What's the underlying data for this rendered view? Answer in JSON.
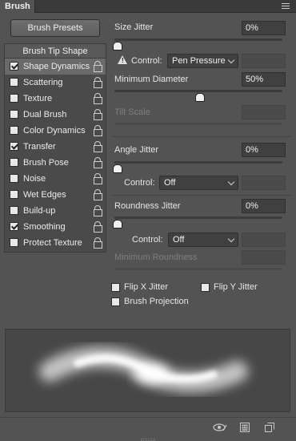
{
  "panel": {
    "title": "Brush"
  },
  "presets_button": "Brush Presets",
  "sidebar": {
    "header": "Brush Tip Shape",
    "items": [
      {
        "label": "Shape Dynamics",
        "checked": true,
        "active": true
      },
      {
        "label": "Scattering",
        "checked": false
      },
      {
        "label": "Texture",
        "checked": false
      },
      {
        "label": "Dual Brush",
        "checked": false
      },
      {
        "label": "Color Dynamics",
        "checked": false
      },
      {
        "label": "Transfer",
        "checked": true
      },
      {
        "label": "Brush Pose",
        "checked": false
      },
      {
        "label": "Noise",
        "checked": false
      },
      {
        "label": "Wet Edges",
        "checked": false
      },
      {
        "label": "Build-up",
        "checked": false
      },
      {
        "label": "Smoothing",
        "checked": true
      },
      {
        "label": "Protect Texture",
        "checked": false
      }
    ]
  },
  "settings": {
    "size_jitter": {
      "label": "Size Jitter",
      "value": "0%",
      "level": 0
    },
    "size_control": {
      "label": "Control:",
      "value": "Pen Pressure"
    },
    "min_diameter": {
      "label": "Minimum Diameter",
      "value": "50%",
      "level": 0.5
    },
    "tilt_scale": {
      "label": "Tilt Scale"
    },
    "angle_jitter": {
      "label": "Angle Jitter",
      "value": "0%",
      "level": 0
    },
    "angle_control": {
      "label": "Control:",
      "value": "Off"
    },
    "roundness_jitter": {
      "label": "Roundness Jitter",
      "value": "0%",
      "level": 0
    },
    "roundness_control": {
      "label": "Control:",
      "value": "Off"
    },
    "min_roundness": {
      "label": "Minimum Roundness"
    },
    "flip_x": {
      "label": "Flip X Jitter",
      "checked": false
    },
    "flip_y": {
      "label": "Flip Y Jitter",
      "checked": false
    },
    "brush_projection": {
      "label": "Brush Projection",
      "checked": false
    }
  },
  "icons": [
    "panel-menu-icon",
    "lock-icon",
    "warning-icon",
    "eye-toggle-icon",
    "grid-icon",
    "new-preset-icon"
  ]
}
